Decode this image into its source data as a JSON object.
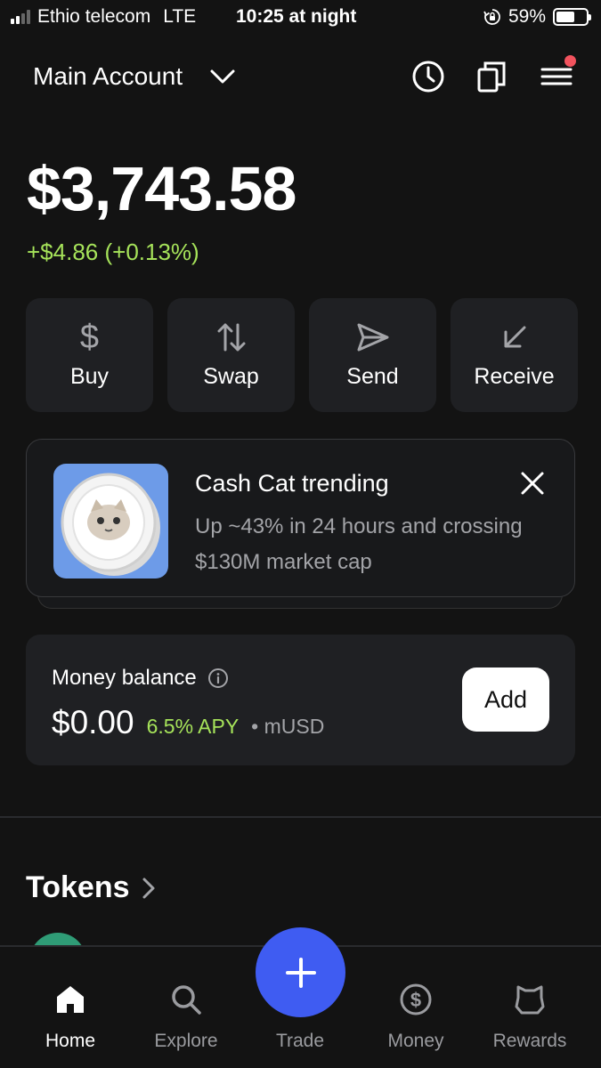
{
  "status_bar": {
    "carrier": "Ethio telecom",
    "network": "LTE",
    "time": "10:25 at night",
    "battery": "59%",
    "battery_level": 0.59
  },
  "header": {
    "account_name": "Main Account",
    "icons": [
      "chevron-down-icon",
      "clock-icon",
      "copy-icon",
      "menu-icon"
    ]
  },
  "portfolio": {
    "balance": "$3,743.58",
    "change": "+$4.86 (+0.13%)"
  },
  "actions": [
    {
      "label": "Buy",
      "icon": "dollar-icon"
    },
    {
      "label": "Swap",
      "icon": "swap-icon"
    },
    {
      "label": "Send",
      "icon": "send-icon"
    },
    {
      "label": "Receive",
      "icon": "receive-icon"
    }
  ],
  "promo": {
    "title": "Cash Cat trending",
    "body": "Up ~43% in 24 hours and crossing $130M market cap"
  },
  "money": {
    "label": "Money balance",
    "amount": "$0.00",
    "apy": "6.5% APY",
    "currency": "mUSD",
    "add_label": "Add"
  },
  "tokens": {
    "title": "Tokens"
  },
  "nav": {
    "home": "Home",
    "explore": "Explore",
    "trade": "Trade",
    "money": "Money",
    "rewards": "Rewards"
  },
  "colors": {
    "background": "#131313",
    "card": "#1f2023",
    "positive": "#a6e35a",
    "trade_button": "#3f5cf2",
    "notification": "#f2535e"
  }
}
